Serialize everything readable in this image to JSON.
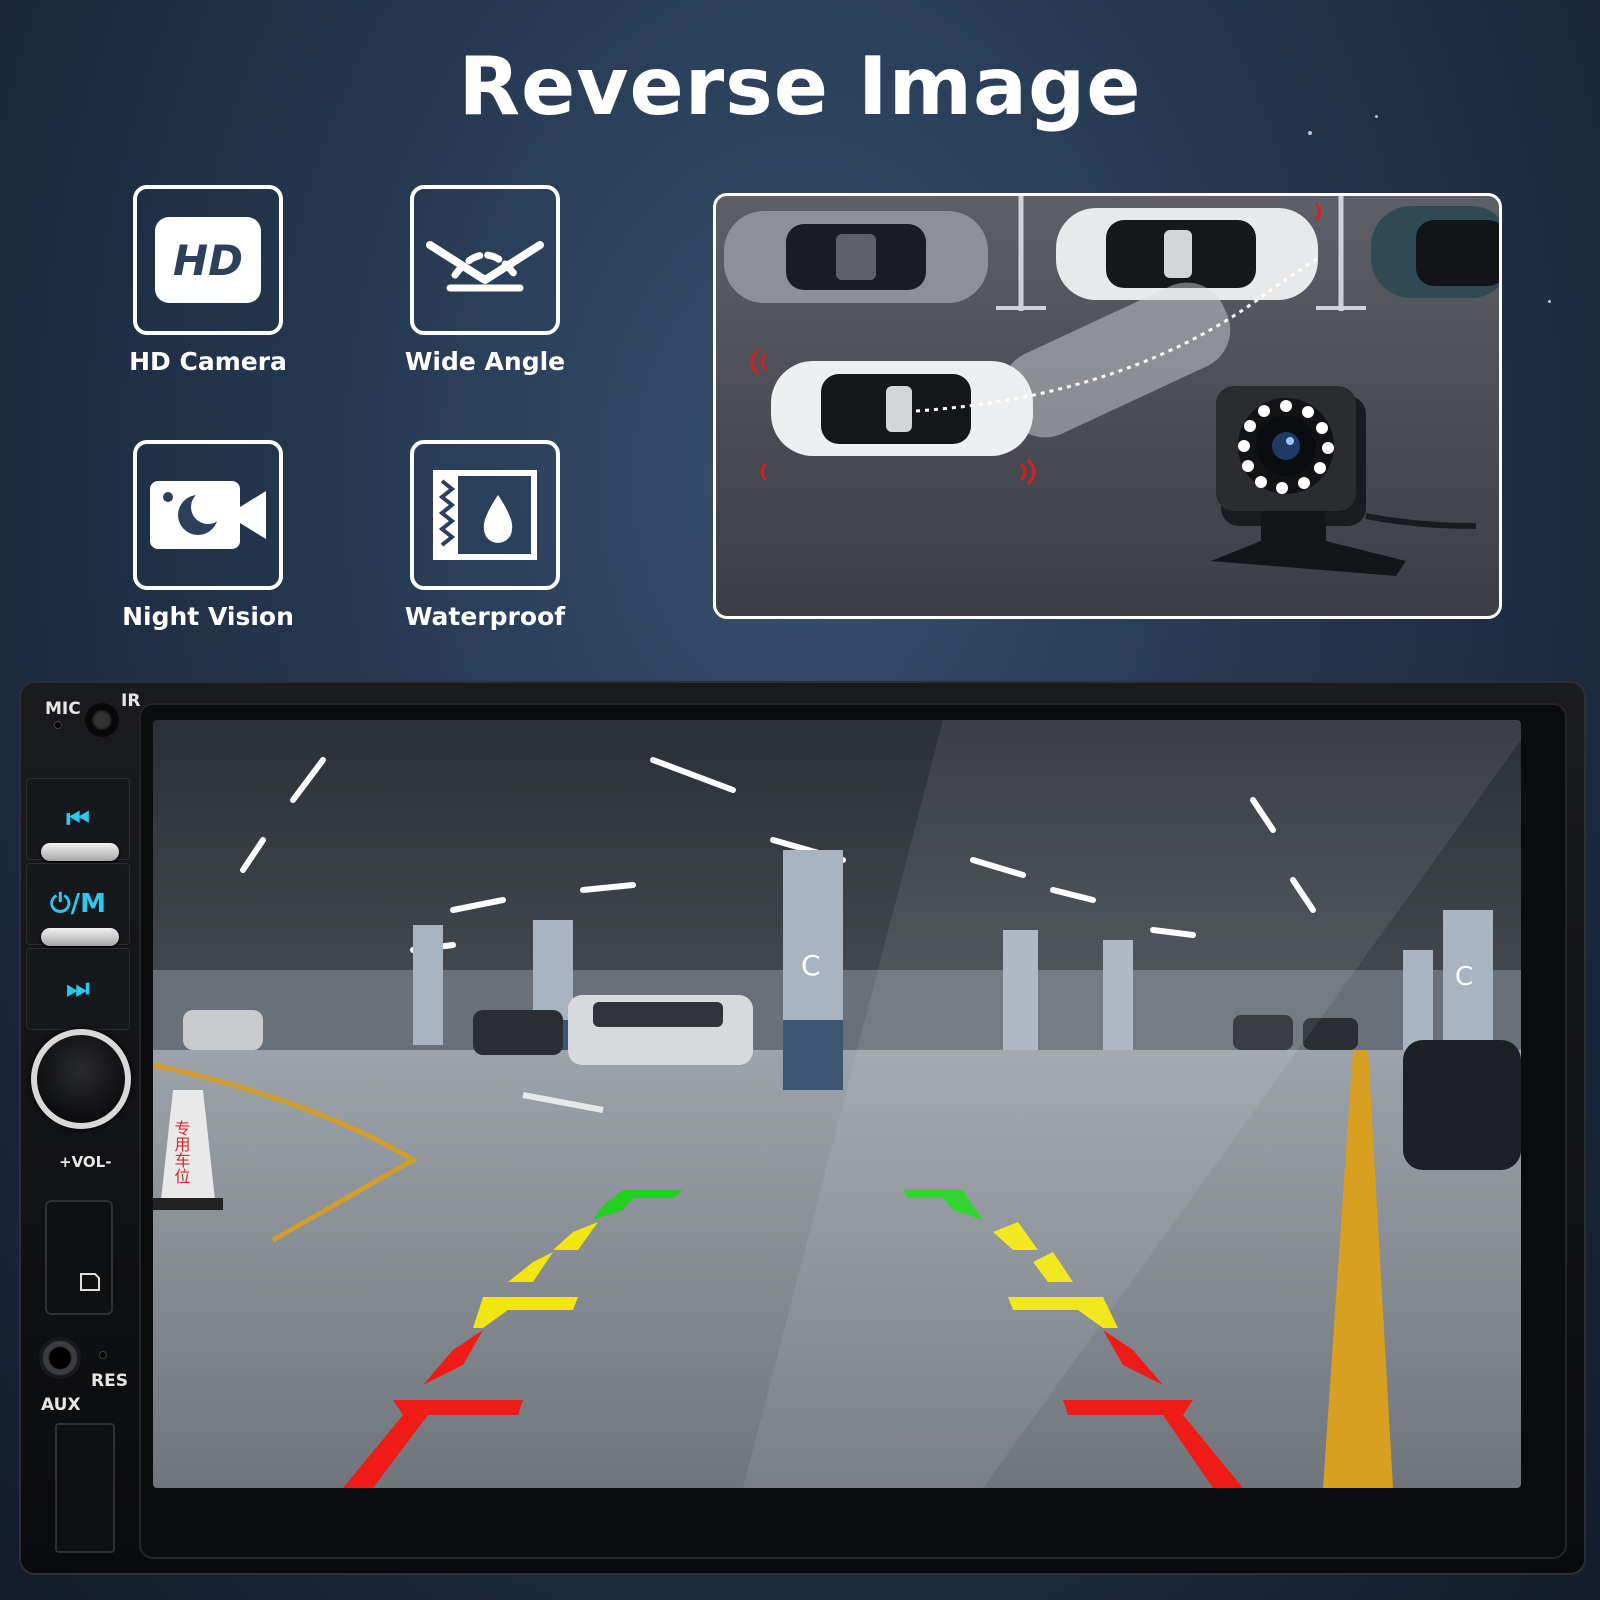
{
  "title": "Reverse Image",
  "features": [
    {
      "label": "HD Camera",
      "icon": "hd-icon",
      "icon_text": "HD"
    },
    {
      "label": "Wide Angle",
      "icon": "wide-angle-icon"
    },
    {
      "label": "Night Vision",
      "icon": "night-vision-camera-icon"
    },
    {
      "label": "Waterproof",
      "icon": "waterproof-icon"
    }
  ],
  "head_unit": {
    "mic_label": "MIC",
    "ir_label": "IR",
    "prev_symbol": "⏮",
    "power_mode_label": "⏻/M",
    "next_symbol": "⏭",
    "volume_label": "+VOL-",
    "res_label": "RES",
    "aux_label": "AUX"
  },
  "parking_signs": {
    "cone_text": "专用车位",
    "pillar_letter": "C"
  },
  "colors": {
    "accent_cyan": "#2dc8f0",
    "guide_green": "#22d11e",
    "guide_yellow": "#f1e60d",
    "guide_red": "#ef1b17",
    "background": "#24364e"
  }
}
